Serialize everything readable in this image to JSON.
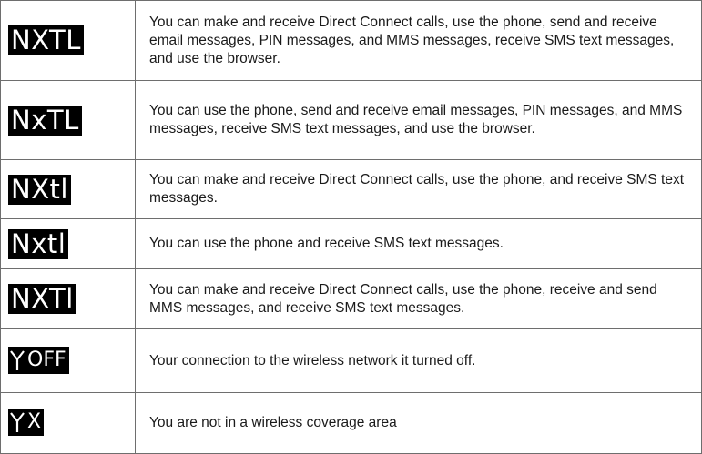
{
  "rows": [
    {
      "icon_label": "NXTL",
      "icon_type": "text-badge",
      "description": "You can make and receive Direct Connect calls, use the phone, send and receive email messages, PIN messages, and MMS messages, receive SMS text messages, and use the browser."
    },
    {
      "icon_label": "NxTL",
      "icon_type": "text-badge",
      "description": "You can use the phone, send and receive email messages, PIN messages, and MMS messages, receive SMS text messages, and use the browser."
    },
    {
      "icon_label": "NXtl",
      "icon_type": "text-badge",
      "description": "You can make and receive Direct Connect calls, use the phone, and receive SMS text messages."
    },
    {
      "icon_label": "Nxtl",
      "icon_type": "text-badge",
      "description": "You can use the phone and receive SMS text messages."
    },
    {
      "icon_label": "NXTl",
      "icon_type": "text-badge",
      "description": "You can make and receive Direct Connect calls, use the phone, receive and send MMS messages, and receive SMS text messages."
    },
    {
      "icon_label": "OFF",
      "icon_type": "antenna-icon",
      "description": "Your connection to the wireless network it turned off."
    },
    {
      "icon_label": "X",
      "icon_type": "antenna-icon",
      "description": "You are not in a wireless coverage area"
    }
  ],
  "colors": {
    "badge_background": "#000000",
    "badge_text": "#ffffff",
    "border": "#6e6e6e",
    "body_text": "#1a1a1a"
  }
}
